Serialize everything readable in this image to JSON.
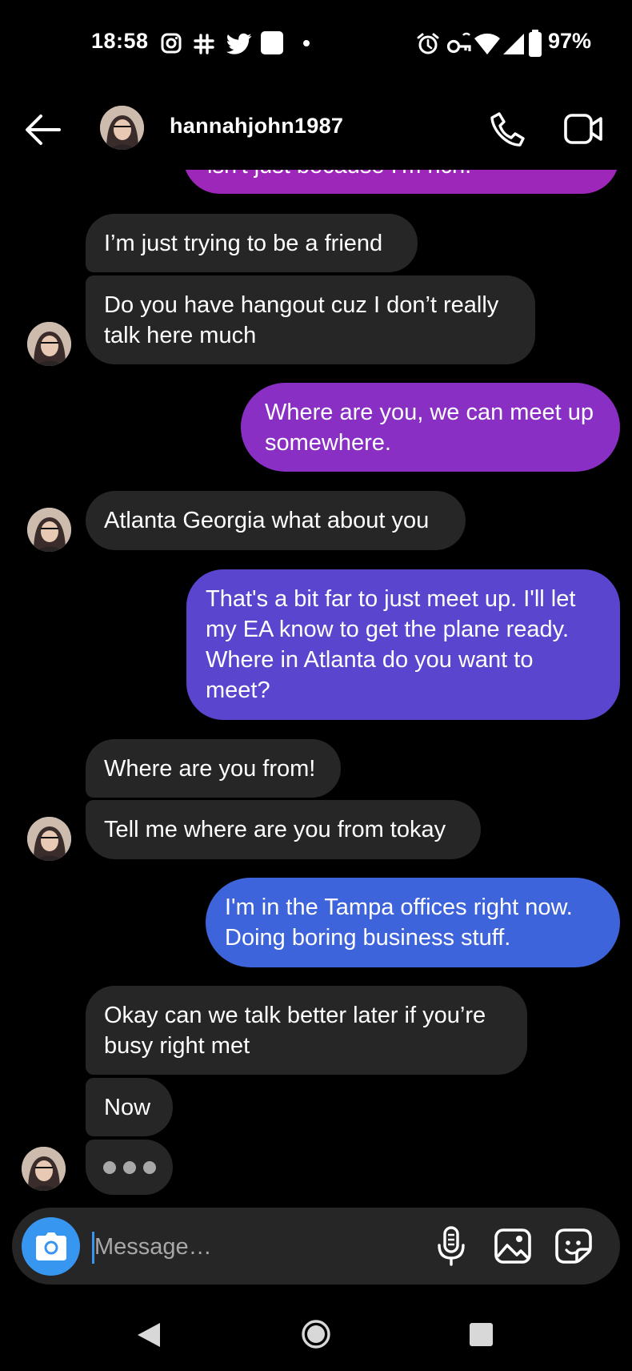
{
  "status_bar": {
    "time": "18:58",
    "battery": "97%"
  },
  "header": {
    "username": "hannahjohn1987"
  },
  "messages": {
    "partial_top": "isn't just because I'm rich.",
    "m1": "I’m just trying to be a friend",
    "m2": "Do you have hangout cuz I don’t really\ntalk here much",
    "m3": "Where are you, we can meet up\nsomewhere.",
    "m4": "Atlanta Georgia what about you",
    "m5": "That's a bit far to just meet up. I'll let\nmy EA know to get the plane ready.\nWhere in Atlanta do you want to\nmeet?",
    "m6": "Where are you from!",
    "m7": "Tell me where are you from tokay",
    "m8": "I'm in the Tampa offices right now.\nDoing boring business stuff.",
    "m9": "Okay can we talk better later if you’re\nbusy right met",
    "m10": "Now"
  },
  "composer": {
    "placeholder": "Message…"
  },
  "colors": {
    "incoming_bubble": "#262626",
    "outgoing_top": "#8a2fc4",
    "outgoing_bottom": "#3e64dc",
    "accent_blue": "#3797f0",
    "background": "#000000"
  }
}
